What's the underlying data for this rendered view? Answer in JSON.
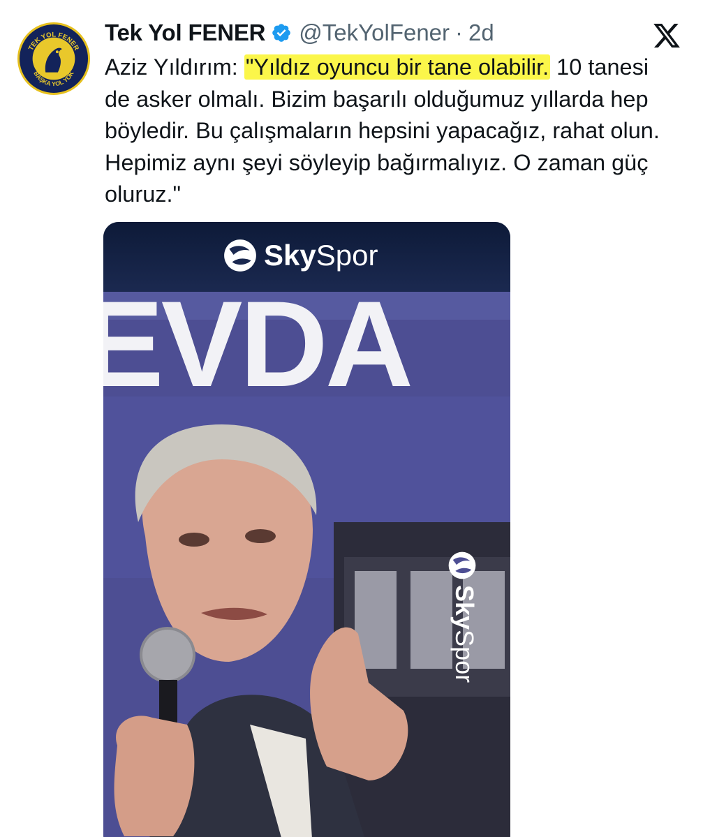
{
  "author": {
    "display_name": "Tek Yol FENER",
    "handle": "@TekYolFener",
    "separator": "·",
    "time_ago": "2d",
    "avatar_text_top": "TEK YOL FENER",
    "avatar_text_bottom": "BAŞKA YOL YOK"
  },
  "tweet": {
    "speaker_prefix": "Aziz Yıldırım: ",
    "highlighted_quote": "\"Yıldız oyuncu bir tane olabilir.",
    "rest_text": " 10 tanesi de asker olmalı. Bizim başarılı olduğumuz yıllarda hep böyledir. Bu çalışmaların hepsini yapacağız, rahat olun. Hepimiz aynı şeyi söyleyip bağırmalıyız. O zaman güç oluruz.\"",
    "highlight_color": "#fbf64a"
  },
  "media": {
    "brand_sky": "Sky",
    "brand_spor": "Spor",
    "banner_letters": "EVDA"
  },
  "icons": {
    "verified": "verified-badge-icon",
    "platform": "x-logo-icon"
  },
  "colors": {
    "text": "#0f1419",
    "secondary": "#536471",
    "verified": "#1d9bf0",
    "banner": "#4f4f96"
  }
}
